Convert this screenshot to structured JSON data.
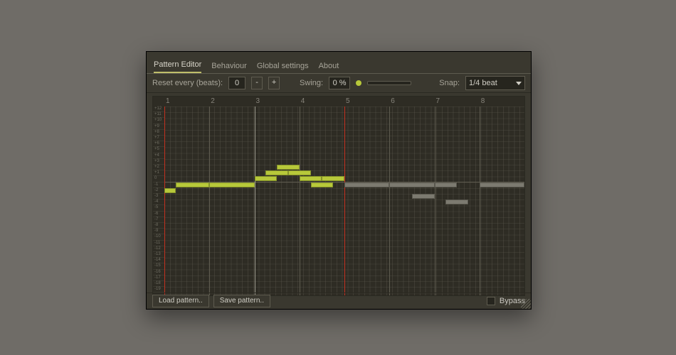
{
  "tabs": [
    "Pattern Editor",
    "Behaviour",
    "Global settings",
    "About"
  ],
  "active_tab": 0,
  "toolbar": {
    "reset_label": "Reset every (beats):",
    "reset_value": "0",
    "minus": "-",
    "plus": "+",
    "swing_label": "Swing:",
    "swing_value": "0 %",
    "snap_label": "Snap:",
    "snap_value": "1/4 beat"
  },
  "ruler": {
    "beats": [
      "1",
      "2",
      "3",
      "4",
      "5",
      "6",
      "7",
      "8"
    ]
  },
  "gutter_labels": [
    "+12",
    "+11",
    "+10",
    "+9",
    "+8",
    "+7",
    "+6",
    "+5",
    "+4",
    "+3",
    "+2",
    "+1",
    "0",
    "-1",
    "-2",
    "-3",
    "-4",
    "-5",
    "-6",
    "-7",
    "-8",
    "-9",
    "-10",
    "-11",
    "-12",
    "-13",
    "-14",
    "-15",
    "-16",
    "-17",
    "-18",
    "-19"
  ],
  "playheads": [
    0,
    4.0
  ],
  "barlines": [
    2.0
  ],
  "notes_green": [
    {
      "beat": 0.0,
      "len": 0.25,
      "row": 14
    },
    {
      "beat": 0.25,
      "len": 0.75,
      "row": 13
    },
    {
      "beat": 1.0,
      "len": 1.0,
      "row": 13
    },
    {
      "beat": 2.0,
      "len": 0.5,
      "row": 12
    },
    {
      "beat": 2.25,
      "len": 0.5,
      "row": 11
    },
    {
      "beat": 2.5,
      "len": 0.5,
      "row": 10
    },
    {
      "beat": 2.75,
      "len": 0.5,
      "row": 11
    },
    {
      "beat": 3.0,
      "len": 0.5,
      "row": 12
    },
    {
      "beat": 3.25,
      "len": 0.5,
      "row": 13
    },
    {
      "beat": 3.5,
      "len": 0.5,
      "row": 12
    }
  ],
  "notes_grey": [
    {
      "beat": 4.0,
      "len": 1.0,
      "row": 13
    },
    {
      "beat": 5.0,
      "len": 1.0,
      "row": 13
    },
    {
      "beat": 5.5,
      "len": 0.5,
      "row": 15
    },
    {
      "beat": 6.0,
      "len": 0.5,
      "row": 13
    },
    {
      "beat": 6.25,
      "len": 0.5,
      "row": 16
    },
    {
      "beat": 7.0,
      "len": 1.0,
      "row": 13
    }
  ],
  "footer": {
    "load": "Load pattern..",
    "save": "Save pattern..",
    "bypass": "Bypass"
  }
}
